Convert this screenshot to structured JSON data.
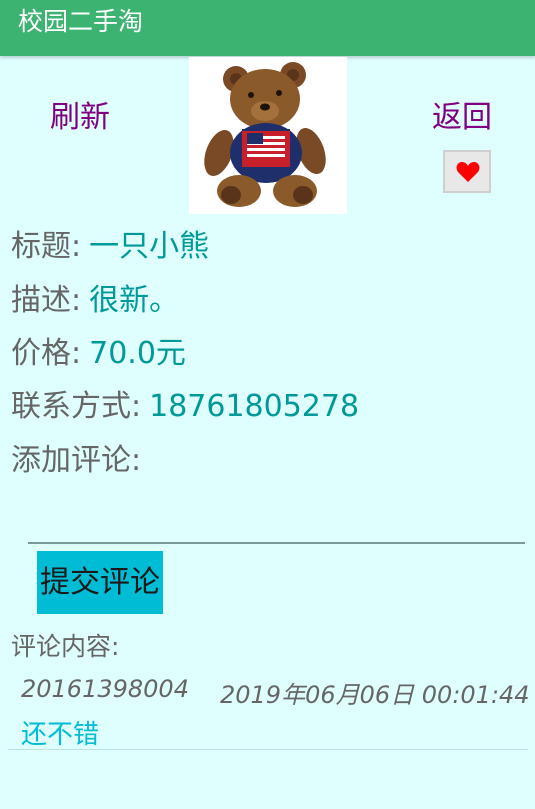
{
  "app": {
    "title": "校园二手淘"
  },
  "toolbar": {
    "refresh_label": "刷新",
    "back_label": "返回"
  },
  "product": {
    "title_label": "标题:",
    "title": "一只小熊",
    "desc_label": "描述:",
    "desc": "很新。",
    "price_label": "价格:",
    "price": "70.0元",
    "contact_label": "联系方式:",
    "contact": "18761805278",
    "image_icon": "teddy-bear-image",
    "favorite_icon": "heart-icon"
  },
  "comment_form": {
    "label": "添加评论:",
    "input_value": "",
    "submit_label": "提交评论"
  },
  "comments": {
    "label": "评论内容:",
    "items": [
      {
        "user": "20161398004",
        "time": "2019年06月06日 00:01:44",
        "text": "还不错"
      }
    ]
  },
  "colors": {
    "header": "#3cb371",
    "background": "#dffefe",
    "action_text": "#800080",
    "value_text": "#009999",
    "button": "#00bcd4",
    "heart": "#ff0000"
  }
}
